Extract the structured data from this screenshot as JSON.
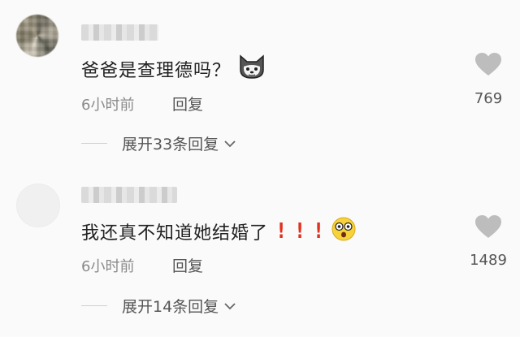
{
  "comments": [
    {
      "text": "爸爸是查理德吗？",
      "time": "6小时前",
      "reply_label": "回复",
      "likes": "769",
      "expand_label": "展开33条回复",
      "emoji": "cat-face-emoji"
    },
    {
      "text": "我还真不知道她结婚了",
      "exclamations": [
        "!",
        "!",
        "!"
      ],
      "time": "6小时前",
      "reply_label": "回复",
      "likes": "1489",
      "expand_label": "展开14条回复",
      "emoji": "surprised-face-emoji"
    }
  ],
  "colors": {
    "background": "#fafafa",
    "text": "#222222",
    "meta": "#8a8a8a",
    "exclamation": "#e0301e",
    "like_icon": "#bdbdbd"
  }
}
